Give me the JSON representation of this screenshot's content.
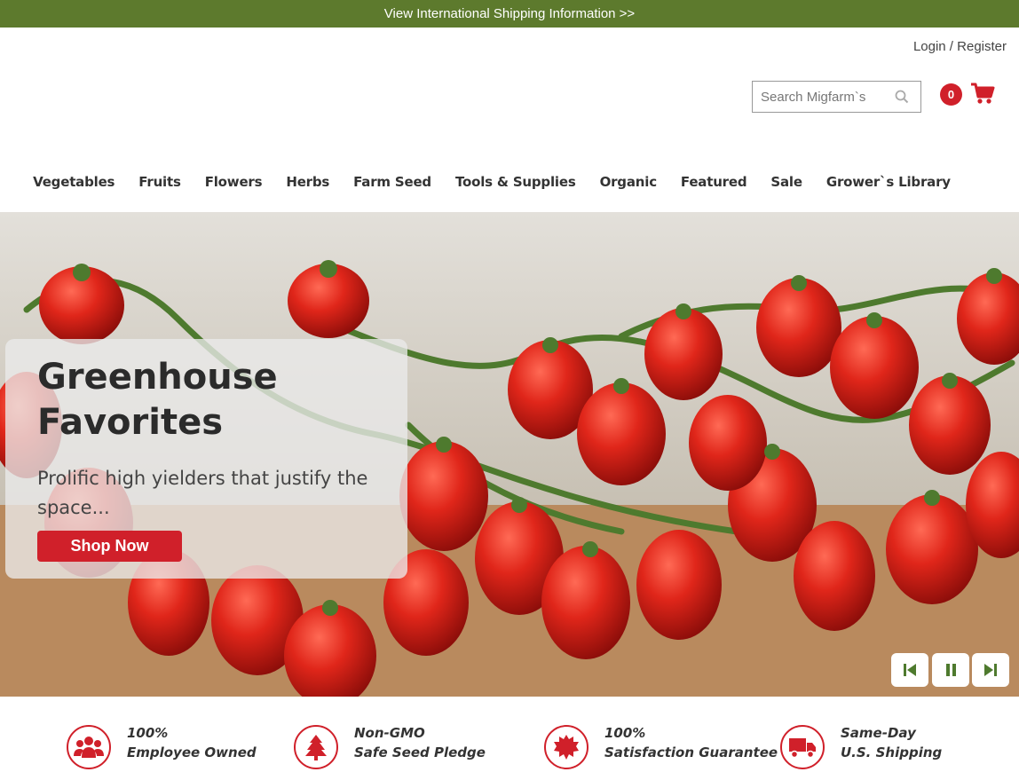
{
  "top_banner": {
    "text": "View International Shipping Information >>"
  },
  "header": {
    "login_label": "Login / Register",
    "search_placeholder": "Search Migfarm`s",
    "cart_count": "0"
  },
  "nav": {
    "items": [
      "Vegetables",
      "Fruits",
      "Flowers",
      "Herbs",
      "Farm Seed",
      "Tools & Supplies",
      "Organic",
      "Featured",
      "Sale",
      "Grower`s Library"
    ]
  },
  "hero": {
    "title_line1": "Greenhouse",
    "title_line2": "Favorites",
    "subtitle": "Prolific high yielders that justify the space...",
    "button_label": "Shop Now",
    "controls": [
      "previous-icon",
      "pause-icon",
      "next-icon"
    ]
  },
  "features": [
    {
      "line1": "100%",
      "line2": "Employee Owned",
      "icon": "people-icon"
    },
    {
      "line1": "Non-GMO",
      "line2": "Safe Seed Pledge",
      "icon": "tree-icon"
    },
    {
      "line1": "100%",
      "line2": "Satisfaction Guarantee",
      "icon": "seal-icon"
    },
    {
      "line1": "Same-Day",
      "line2": "U.S. Shipping",
      "icon": "truck-icon"
    }
  ],
  "colors": {
    "brand_green": "#5d7a2d",
    "accent_red": "#d0202a"
  }
}
